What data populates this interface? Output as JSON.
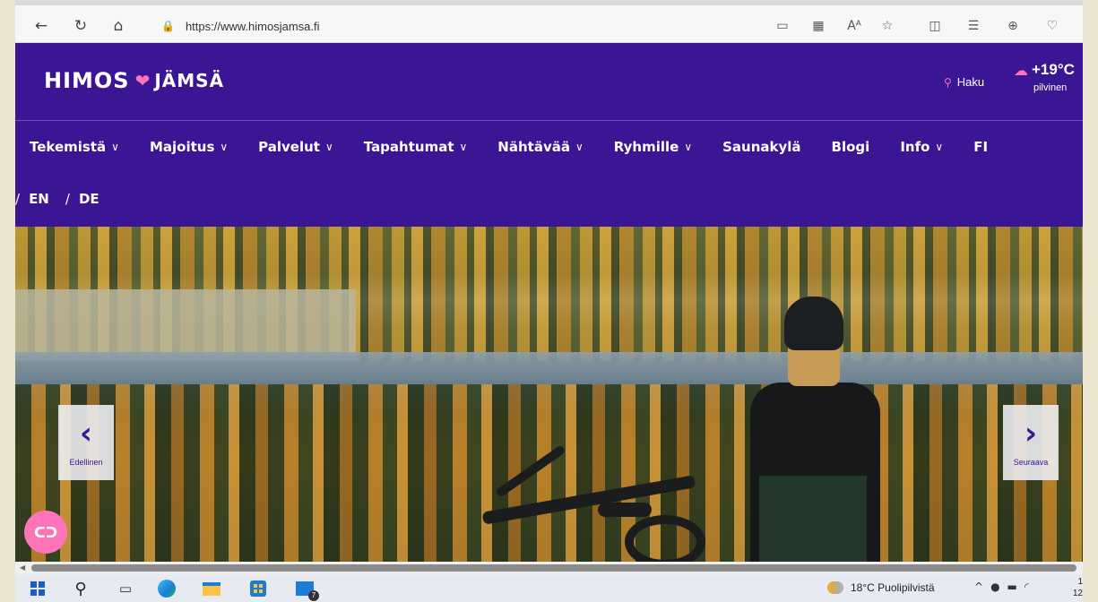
{
  "browser": {
    "url": "https://www.himosjamsa.fi",
    "back_icon": "arrow-left-icon",
    "reload_icon": "reload-icon",
    "home_icon": "home-icon"
  },
  "header": {
    "logo_first": "HIMOS",
    "logo_second": "JÄMSÄ",
    "search_label": "Haku",
    "weather_temp": "+19°C",
    "weather_condition": "pilvinen"
  },
  "nav": {
    "items": [
      {
        "label": "Tekemistä",
        "has_dropdown": true
      },
      {
        "label": "Majoitus",
        "has_dropdown": true
      },
      {
        "label": "Palvelut",
        "has_dropdown": true
      },
      {
        "label": "Tapahtumat",
        "has_dropdown": true
      },
      {
        "label": "Nähtävää",
        "has_dropdown": true
      },
      {
        "label": "Ryhmille",
        "has_dropdown": true
      },
      {
        "label": "Saunakylä",
        "has_dropdown": false
      },
      {
        "label": "Blogi",
        "has_dropdown": false
      },
      {
        "label": "Info",
        "has_dropdown": true
      },
      {
        "label": "FI",
        "has_dropdown": false
      }
    ],
    "languages": [
      "EN",
      "DE"
    ]
  },
  "hero": {
    "prev_label": "Edellinen",
    "next_label": "Seuraava"
  },
  "taskbar": {
    "mail_badge": "7",
    "weather": "18°C  Puolipilvistä",
    "clock_line1": "1",
    "clock_line2": "12"
  },
  "colors": {
    "brand_purple": "#3a1594",
    "accent_pink": "#ff74b8"
  }
}
